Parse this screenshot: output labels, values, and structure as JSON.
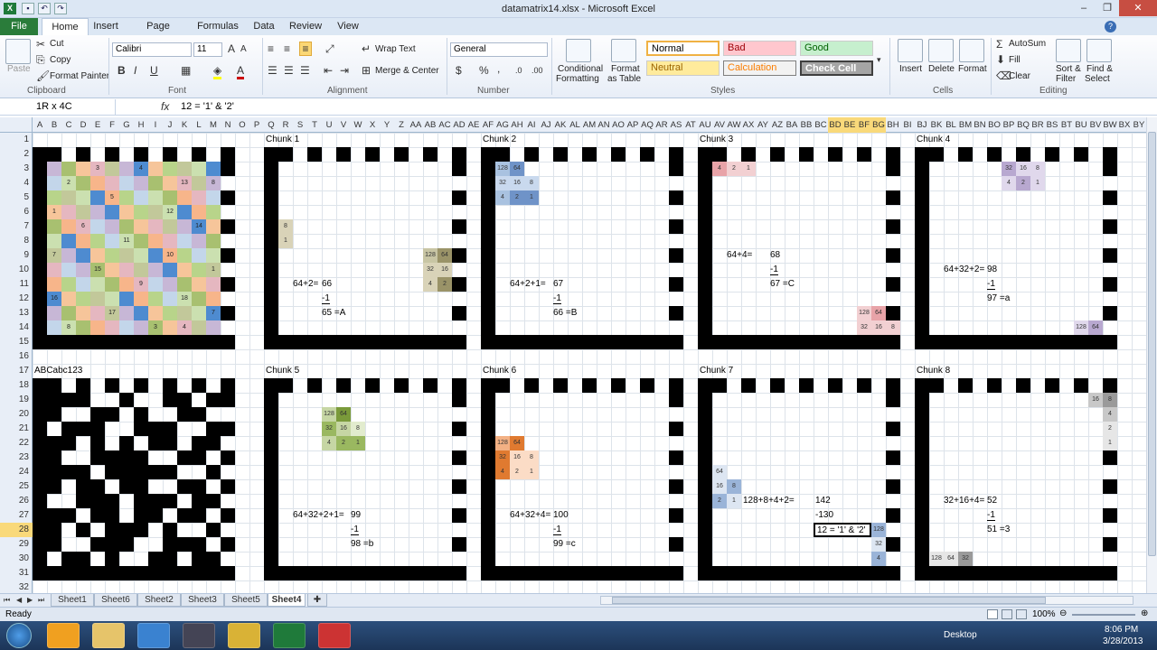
{
  "window": {
    "title": "datamatrix14.xlsx - Microsoft Excel",
    "min": "–",
    "max": "❐",
    "close": "✕"
  },
  "tabs": [
    "File",
    "Home",
    "Insert",
    "Page Layout",
    "Formulas",
    "Data",
    "Review",
    "View"
  ],
  "ribbon": {
    "clipboard": {
      "paste": "Paste",
      "cut": "Cut",
      "copy": "Copy",
      "format_painter": "Format Painter",
      "name": "Clipboard"
    },
    "font": {
      "family": "Calibri",
      "size": "11",
      "name": "Font",
      "bold": "B",
      "italic": "I",
      "underline": "U"
    },
    "alignment": {
      "wrap": "Wrap Text",
      "merge": "Merge & Center",
      "name": "Alignment"
    },
    "number": {
      "format": "General",
      "currency": "$",
      "percent": "%",
      "comma": ",",
      "name": "Number"
    },
    "styles": {
      "conditional": "Conditional",
      "conditional2": "Formatting",
      "format_table": "Format",
      "format_table2": "as Table",
      "normal": "Normal",
      "bad": "Bad",
      "good": "Good",
      "neutral": "Neutral",
      "calculation": "Calculation",
      "check_cell": "Check Cell",
      "name": "Styles"
    },
    "cells": {
      "insert": "Insert",
      "delete": "Delete",
      "format": "Format",
      "name": "Cells"
    },
    "editing": {
      "autosum": "AutoSum",
      "fill": "Fill",
      "clear": "Clear",
      "sort": "Sort &",
      "sort2": "Filter",
      "find": "Find &",
      "find2": "Select",
      "name": "Editing"
    }
  },
  "formula_bar": {
    "name_box": "1R x 4C",
    "fx": "fx",
    "content": "12 = '1' & '2'"
  },
  "columns": [
    "A",
    "B",
    "C",
    "D",
    "E",
    "F",
    "G",
    "H",
    "I",
    "J",
    "K",
    "L",
    "M",
    "N",
    "O",
    "P",
    "Q",
    "R",
    "S",
    "T",
    "U",
    "V",
    "W",
    "X",
    "Y",
    "Z",
    "AA",
    "AB",
    "AC",
    "AD",
    "AE",
    "AF",
    "AG",
    "AH",
    "AI",
    "AJ",
    "AK",
    "AL",
    "AM",
    "AN",
    "AO",
    "AP",
    "AQ",
    "AR",
    "AS",
    "AT",
    "AU",
    "AV",
    "AW",
    "AX",
    "AY",
    "AZ",
    "BA",
    "BB",
    "BC",
    "BD",
    "BE",
    "BF",
    "BG",
    "BH",
    "BI",
    "BJ",
    "BK",
    "BL",
    "BM",
    "BN",
    "BO",
    "BP",
    "BQ",
    "BR",
    "BS",
    "BT",
    "BU",
    "BV",
    "BW",
    "BX",
    "BY",
    "BZ"
  ],
  "rows": [
    "1",
    "2",
    "3",
    "4",
    "5",
    "6",
    "7",
    "8",
    "9",
    "10",
    "11",
    "12",
    "13",
    "14",
    "15",
    "16",
    "17",
    "18",
    "19",
    "20",
    "21",
    "22",
    "23",
    "24",
    "25",
    "26",
    "27",
    "28",
    "29",
    "30",
    "31",
    "32"
  ],
  "labels": {
    "chunk1": "Chunk 1",
    "chunk2": "Chunk 2",
    "chunk3": "Chunk 3",
    "chunk4": "Chunk 4",
    "chunk5": "Chunk 5",
    "chunk6": "Chunk 6",
    "chunk7": "Chunk 7",
    "chunk8": "Chunk 8",
    "text": "ABCabc123"
  },
  "color_map_values": [
    "3",
    "4",
    "2",
    "13",
    "8",
    "5",
    "1",
    "12",
    "6",
    "14",
    "11",
    "7",
    "10",
    "15",
    "1",
    "9",
    "16",
    "18",
    "17",
    "7",
    "8",
    "3",
    "4"
  ],
  "bit_cells": {
    "c1a": [
      "8",
      "1"
    ],
    "c1b": [
      "128",
      "64",
      "32",
      "16",
      "4",
      "2"
    ],
    "c2a": [
      "128",
      "64",
      "32",
      "16",
      "8",
      "4",
      "2",
      "1"
    ],
    "c3a": [
      "4",
      "2",
      "1"
    ],
    "c3b": [
      "128",
      "64",
      "32",
      "16",
      "8"
    ],
    "c4a": [
      "32",
      "16",
      "8",
      "4",
      "2",
      "1"
    ],
    "c4b": [
      "128",
      "64"
    ],
    "c5a": [
      "128",
      "64",
      "32",
      "16",
      "8",
      "4",
      "2",
      "1"
    ],
    "c6a": [
      "128",
      "64",
      "32",
      "16",
      "8",
      "4",
      "2",
      "1"
    ],
    "c7a": [
      "64",
      "16",
      "8",
      "2",
      "1"
    ],
    "c7b": [
      "128",
      "32",
      "4"
    ],
    "c8a": [
      "16",
      "8",
      "4",
      "2",
      "1"
    ],
    "c8b": [
      "128",
      "64",
      "32"
    ]
  },
  "calcs": {
    "c1": {
      "sum": "64+2=",
      "v": "66",
      "m": "-1",
      "r": "65 =A"
    },
    "c2": {
      "sum": "64+2+1=",
      "v": "67",
      "m": "-1",
      "r": "66 =B"
    },
    "c3": {
      "sum": "64+4=",
      "v": "68",
      "m": "-1",
      "r": "67 =C"
    },
    "c4": {
      "sum": "64+32+2=",
      "v": "98",
      "m": "-1",
      "r": "97 =a"
    },
    "c5": {
      "sum": "64+32+2+1=",
      "v": "99",
      "m": "-1",
      "r": "98 =b"
    },
    "c6": {
      "sum": "64+32+4=",
      "v": "100",
      "m": "-1",
      "r": "99 =c"
    },
    "c7": {
      "sum": "128+8+4+2=",
      "v": "142",
      "m": "-130",
      "r": "12 = '1' & '2'"
    },
    "c8": {
      "sum": "32+16+4=",
      "v": "52",
      "m": "-1",
      "r": "51 =3"
    }
  },
  "sheets": [
    "Sheet1",
    "Sheet6",
    "Sheet2",
    "Sheet3",
    "Sheet5",
    "Sheet4"
  ],
  "status": {
    "ready": "Ready",
    "zoom": "100%"
  },
  "taskbar": {
    "desktop": "Desktop",
    "time": "8:06 PM",
    "date": "3/28/2013"
  }
}
